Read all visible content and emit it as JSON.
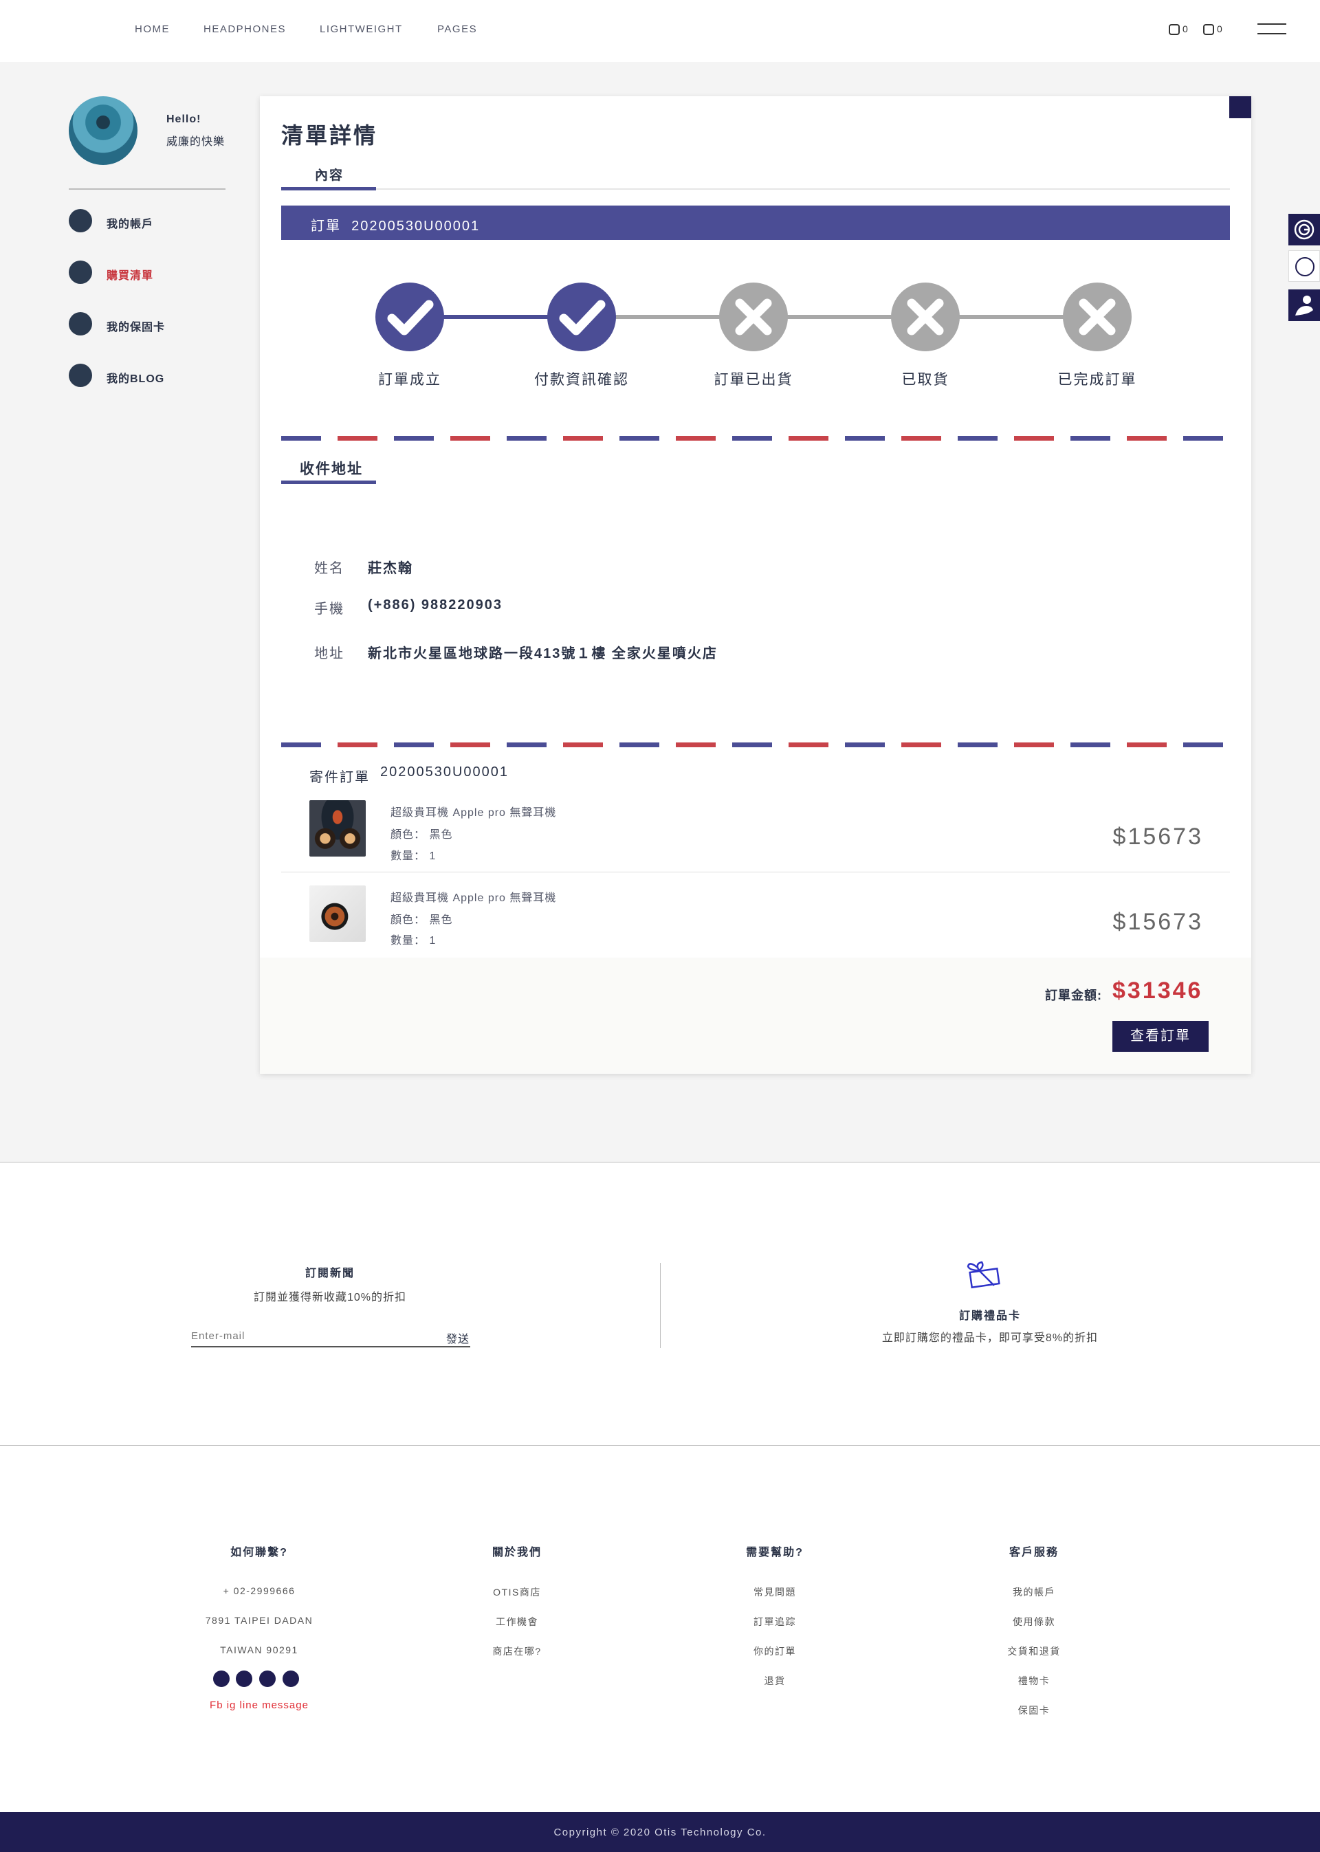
{
  "nav": {
    "items": [
      "HOME",
      "HEADPHONES",
      "LIGHTWEIGHT",
      "PAGES"
    ],
    "cart_count": "0",
    "wishlist_count": "0"
  },
  "user": {
    "hello": "Hello!",
    "name": "威廉的快樂"
  },
  "sidebar": {
    "items": [
      {
        "label": "我的帳戶",
        "active": false
      },
      {
        "label": "購買清單",
        "active": true
      },
      {
        "label": "我的保固卡",
        "active": false
      },
      {
        "label": "我的BLOG",
        "active": false
      }
    ]
  },
  "colors": {
    "accent": "#4b4d95",
    "dark": "#1f1d52",
    "active_red": "#c8363e",
    "pending_gray": "#a8a8a8"
  },
  "order": {
    "title": "清單詳情",
    "tab": "內容",
    "bar_label": "訂單",
    "bar_code": "20200530U00001",
    "steps": [
      {
        "label": "訂單成立",
        "done": true
      },
      {
        "label": "付款資訊確認",
        "done": true
      },
      {
        "label": "訂單已出貨",
        "done": false
      },
      {
        "label": "已取貨",
        "done": false
      },
      {
        "label": "已完成訂單",
        "done": false
      }
    ]
  },
  "address": {
    "section": "收件地址",
    "name_label": "姓名",
    "name_value": "莊杰翰",
    "phone_label": "手機",
    "phone_value": "(+886) 988220903",
    "addr_label": "地址",
    "addr_value": "新北市火星區地球路一段413號１樓 全家火星噴火店"
  },
  "shipment": {
    "label": "寄件訂單",
    "code": "20200530U00001",
    "products": [
      {
        "name": "超級貴耳機 Apple pro 無聲耳機",
        "color": "顏色：  黑色",
        "qty": "數量：  1",
        "price": "$15673"
      },
      {
        "name": "超級貴耳機 Apple pro 無聲耳機",
        "color": "顏色：  黑色",
        "qty": "數量：  1",
        "price": "$15673"
      }
    ],
    "total_label": "訂單金額:",
    "total_value": "$31346",
    "view_button": "查看訂單"
  },
  "newsletter": {
    "title": "訂閱新聞",
    "subtitle": "訂閱並獲得新收藏10%的折扣",
    "placeholder": "Enter-mail",
    "send": "發送"
  },
  "gift": {
    "title": "訂購禮品卡",
    "subtitle": "立即訂購您的禮品卡，即可享受8%的折扣"
  },
  "footer": {
    "columns": [
      {
        "title": "如何聯繫?",
        "items": [
          "+ 02-2999666",
          "7891 TAIPEI DADAN",
          "TAIWAN 90291"
        ]
      },
      {
        "title": "關於我們",
        "items": [
          "OTIS商店",
          "工作機會",
          "商店在哪?"
        ]
      },
      {
        "title": "需要幫助?",
        "items": [
          "常見問題",
          "訂單追踪",
          "你的訂單",
          "退貨"
        ]
      },
      {
        "title": "客戶服務",
        "items": [
          "我的帳戶",
          "使用條款",
          "交貨和退貨",
          "禮物卡",
          "保固卡"
        ]
      }
    ],
    "social_text": "Fb ig line message",
    "copyright": "Copyright © 2020 Otis Technology Co."
  }
}
